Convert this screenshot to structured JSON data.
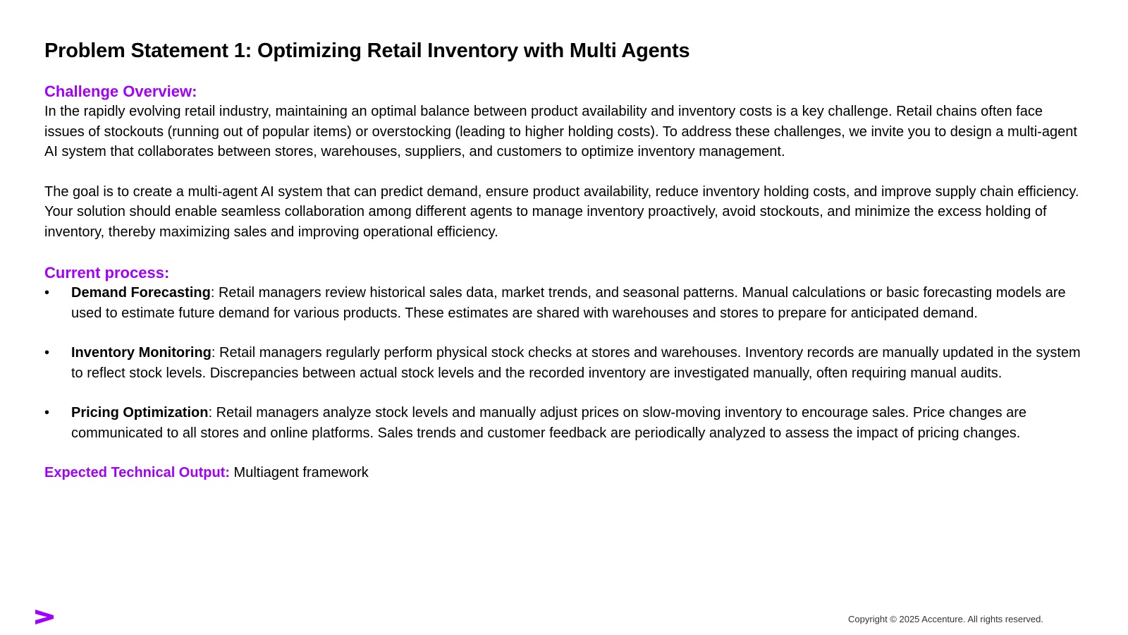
{
  "title": "Problem Statement 1: Optimizing Retail Inventory with Multi Agents",
  "challenge": {
    "heading": "Challenge Overview:",
    "paragraphs": [
      "In the rapidly evolving retail industry, maintaining an optimal balance between product availability and inventory costs is a key challenge. Retail chains often face issues of stockouts (running out of popular items) or overstocking (leading to higher holding costs). To address these challenges, we invite you to design a multi-agent AI system that collaborates between stores, warehouses, suppliers, and customers to optimize inventory management.",
      "The goal is to create a multi-agent AI system that can predict demand, ensure product availability, reduce inventory holding costs, and improve supply chain efficiency. Your solution should enable seamless collaboration among different agents to manage inventory proactively, avoid stockouts, and minimize the excess holding of inventory, thereby maximizing sales and improving operational efficiency."
    ]
  },
  "current_process": {
    "heading": "Current process:",
    "bullet_symbol": "•",
    "items": [
      {
        "term": "Demand Forecasting",
        "text": ": Retail managers review historical sales data, market trends, and seasonal patterns. Manual calculations or basic forecasting models are used to estimate future demand for various products. These estimates are shared with warehouses and stores to prepare for anticipated demand."
      },
      {
        "term": "Inventory Monitoring",
        "text": ": Retail managers regularly perform physical stock checks at stores and warehouses. Inventory records are manually updated in the system to reflect stock levels. Discrepancies between actual stock levels and the recorded inventory are investigated manually, often requiring manual audits."
      },
      {
        "term": "Pricing Optimization",
        "text": ": Retail managers analyze stock levels and manually adjust prices on slow-moving inventory to encourage sales. Price changes are communicated to all stores and online platforms. Sales trends and customer feedback are periodically analyzed to assess the impact of pricing changes."
      }
    ]
  },
  "expected": {
    "label": "Expected Technical Output:",
    "value": " Multiagent framework"
  },
  "footer": {
    "copyright": "Copyright © 2025 Accenture. All rights reserved.",
    "logo_icon": "accenture-chevron-icon",
    "brand_color": "#a100ff"
  }
}
